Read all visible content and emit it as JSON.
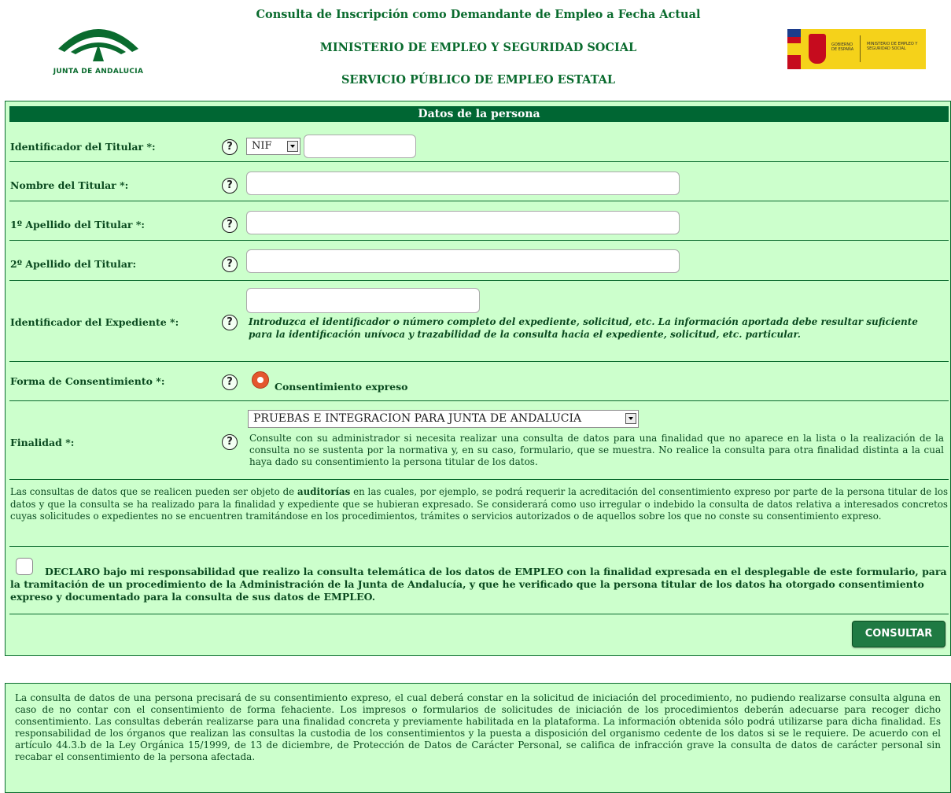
{
  "header": {
    "logo_left_text": "JUNTA DE ANDALUCIA",
    "title_line1": "Consulta de Inscripción como Demandante de Empleo a Fecha Actual",
    "title_line2": "MINISTERIO DE EMPLEO Y SEGURIDAD SOCIAL",
    "title_line3": "SERVICIO PÚBLICO DE EMPLEO ESTATAL",
    "logo_right_text1": "GOBIERNO DE ESPAÑA",
    "logo_right_text2": "MINISTERIO DE EMPLEO Y SEGURIDAD SOCIAL"
  },
  "form": {
    "panel_title": "Datos de la persona",
    "help_glyph": "?",
    "fields": {
      "identificador_label": "Identificador del Titular *:",
      "doc_type_selected": "NIF",
      "identificador_value": "",
      "nombre_label": "Nombre del Titular *:",
      "nombre_value": "",
      "apellido1_label": "1º Apellido del Titular *:",
      "apellido1_value": "",
      "apellido2_label": "2º Apellido del Titular:",
      "apellido2_value": "",
      "expediente_label": "Identificador del Expediente *:",
      "expediente_value": "",
      "expediente_note": "Introduzca el identificador o número completo del expediente, solicitud, etc. La información aportada debe resultar suficiente para la identificación unívoca y trazabilidad de la consulta hacia el expediente, solicitud, etc. particular.",
      "consentimiento_label": "Forma de Consentimiento *:",
      "consentimiento_option": "Consentimiento expreso",
      "finalidad_label": "Finalidad *:",
      "finalidad_selected": "PRUEBAS E INTEGRACION PARA JUNTA DE ANDALUCIA",
      "finalidad_note": "Consulte con su administrador si necesita realizar una consulta de datos para una finalidad que no aparece en la lista o la realización de la consulta no se sustenta por la normativa y, en su caso, formulario, que se muestra. No realice la consulta para otra finalidad distinta a la cual haya dado su consentimiento la persona titular de los datos."
    },
    "auditoria": {
      "pre": "Las consultas de datos que se realicen pueden ser objeto de ",
      "bold": "auditorías",
      "post": " en las cuales, por ejemplo, se podrá requerir la acreditación del consentimiento expreso por parte de la persona titular de los datos y que la consulta se ha realizado para la finalidad y expediente que se hubieran expresado. Se considerará como uso irregular o indebido la consulta de datos relativa a interesados concretos cuyas solicitudes o expedientes no se encuentren tramitándose en los procedimientos, trámites o servicios autorizados o de aquellos sobre los que no conste su consentimiento expreso."
    },
    "declaro_text": "DECLARO bajo mi responsabilidad que realizo la consulta telemática de los datos de EMPLEO con la finalidad expresada en el desplegable de este formulario, para la tramitación de un procedimiento de la Administración de la Junta de Andalucía, y que he verificado que la persona titular de los datos ha otorgado consentimiento expreso y documentado para la consulta de sus datos de EMPLEO.",
    "submit_label": "CONSULTAR"
  },
  "footer_note": "La consulta de datos de una persona precisará de su consentimiento expreso, el cual deberá constar en la solicitud de iniciación del procedimiento, no pudiendo realizarse consulta alguna en caso de no contar con el consentimiento de forma fehaciente. Los impresos o formularios de solicitudes de iniciación de los procedimientos deberán adecuarse para recoger dicho consentimiento. Las consultas deberán realizarse para una finalidad concreta y previamente habilitada en la plataforma. La información obtenida sólo podrá utilizarse para dicha finalidad. Es responsabilidad de los órganos que realizan las consultas la custodia de los consentimientos y la puesta a disposición del organismo cedente de los datos si se le requiere. De acuerdo con el artículo 44.3.b de la Ley Orgánica 15/1999, de 13 de diciembre, de Protección de Datos de Carácter Personal, se califica de infracción grave la consulta de datos de carácter personal sin recabar el consentimiento de la persona afectada.",
  "colors": {
    "panel_bg": "#ccffcc",
    "title_bar": "#006633",
    "text_green": "#0a4a1f",
    "button": "#1f7a43",
    "radio": "#e4572e"
  }
}
